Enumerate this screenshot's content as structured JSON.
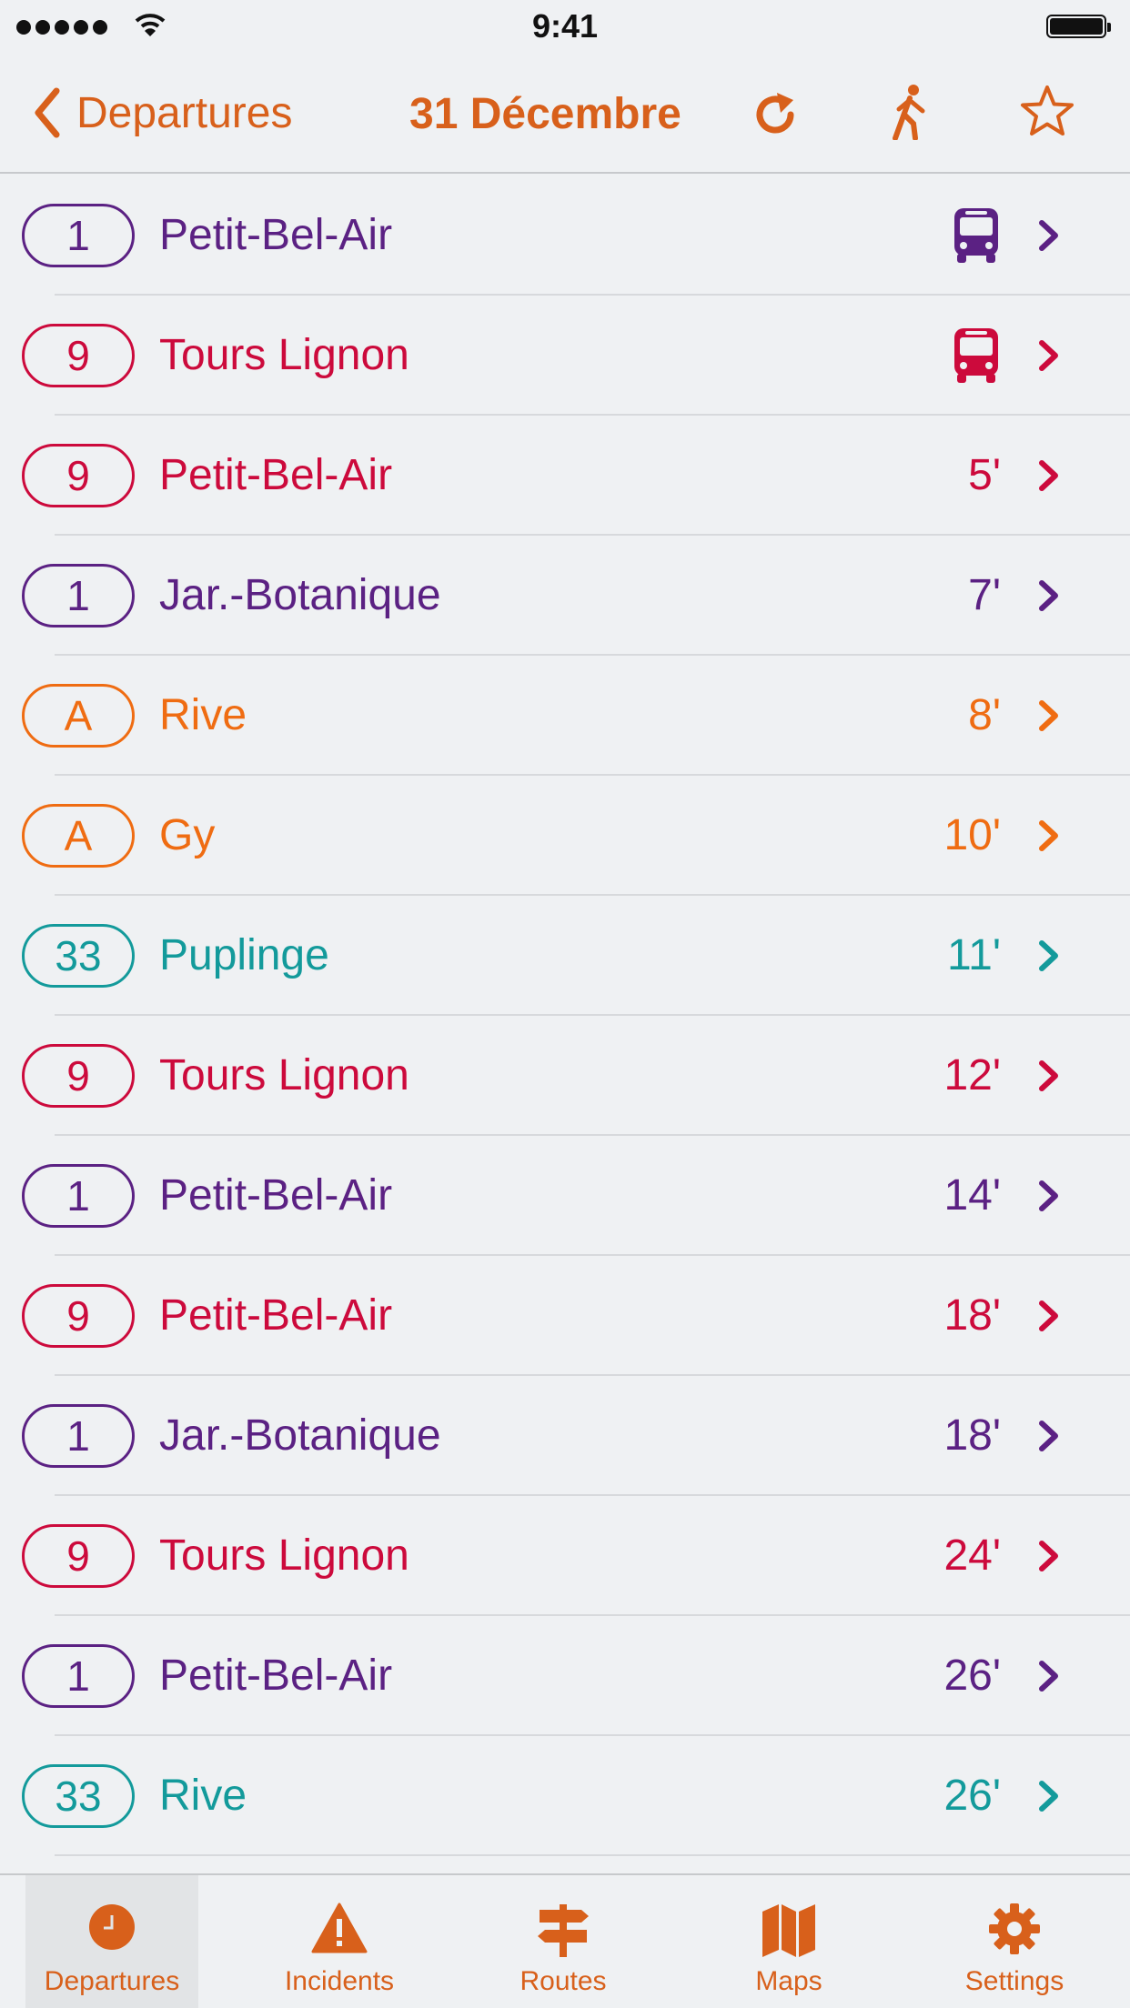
{
  "status_bar": {
    "time": "9:41"
  },
  "nav": {
    "back_label": "Departures",
    "title": "31 Décembre",
    "icons": [
      "refresh-icon",
      "walking-icon",
      "star-icon"
    ]
  },
  "colors": {
    "accent": "#d8601b",
    "line_1": "#5b2183",
    "line_9": "#cc0a3c",
    "line_A": "#ef6c12",
    "line_33": "#139a9b"
  },
  "departures": [
    {
      "line": "1",
      "destination": "Petit-Bel-Air",
      "time": "",
      "icon": "bus-icon",
      "color": "#5b2183"
    },
    {
      "line": "9",
      "destination": "Tours Lignon",
      "time": "",
      "icon": "bus-icon",
      "color": "#cc0a3c"
    },
    {
      "line": "9",
      "destination": "Petit-Bel-Air",
      "time": "5'",
      "color": "#cc0a3c"
    },
    {
      "line": "1",
      "destination": "Jar.-Botanique",
      "time": "7'",
      "color": "#5b2183"
    },
    {
      "line": "A",
      "destination": "Rive",
      "time": "8'",
      "color": "#ef6c12"
    },
    {
      "line": "A",
      "destination": "Gy",
      "time": "10'",
      "color": "#ef6c12"
    },
    {
      "line": "33",
      "destination": "Puplinge",
      "time": "11'",
      "color": "#139a9b"
    },
    {
      "line": "9",
      "destination": "Tours Lignon",
      "time": "12'",
      "color": "#cc0a3c"
    },
    {
      "line": "1",
      "destination": "Petit-Bel-Air",
      "time": "14'",
      "color": "#5b2183"
    },
    {
      "line": "9",
      "destination": "Petit-Bel-Air",
      "time": "18'",
      "color": "#cc0a3c"
    },
    {
      "line": "1",
      "destination": "Jar.-Botanique",
      "time": "18'",
      "color": "#5b2183"
    },
    {
      "line": "9",
      "destination": "Tours Lignon",
      "time": "24'",
      "color": "#cc0a3c"
    },
    {
      "line": "1",
      "destination": "Petit-Bel-Air",
      "time": "26'",
      "color": "#5b2183"
    },
    {
      "line": "33",
      "destination": "Rive",
      "time": "26'",
      "color": "#139a9b"
    }
  ],
  "tabs": [
    {
      "label": "Departures",
      "icon": "clock-icon",
      "active": true
    },
    {
      "label": "Incidents",
      "icon": "warning-icon"
    },
    {
      "label": "Routes",
      "icon": "signpost-icon"
    },
    {
      "label": "Maps",
      "icon": "map-icon"
    },
    {
      "label": "Settings",
      "icon": "gear-icon"
    }
  ]
}
